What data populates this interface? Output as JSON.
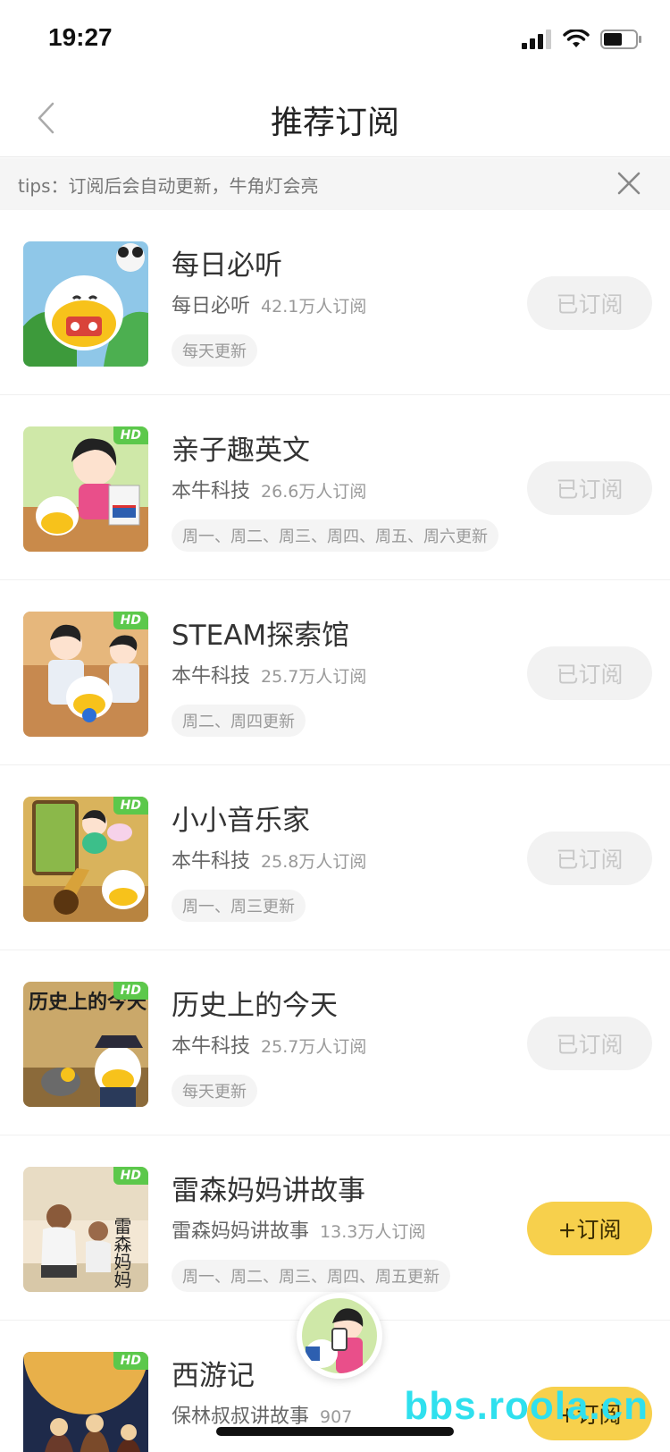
{
  "status_bar": {
    "time": "19:27"
  },
  "nav": {
    "title": "推荐订阅"
  },
  "tips": {
    "text": "tips：订阅后会自动更新，牛角灯会亮"
  },
  "subscriptions": [
    {
      "title": "每日必听",
      "author": "每日必听",
      "count": "42.1万人订阅",
      "schedule": "每天更新",
      "hd": false,
      "button": "已订阅",
      "subscribed": true
    },
    {
      "title": "亲子趣英文",
      "author": "本牛科技",
      "count": "26.6万人订阅",
      "schedule": "周一、周二、周三、周四、周五、周六更新",
      "hd": true,
      "hd_label": "HD",
      "button": "已订阅",
      "subscribed": true
    },
    {
      "title": "STEAM探索馆",
      "author": "本牛科技",
      "count": "25.7万人订阅",
      "schedule": "周二、周四更新",
      "hd": true,
      "hd_label": "HD",
      "button": "已订阅",
      "subscribed": true
    },
    {
      "title": "小小音乐家",
      "author": "本牛科技",
      "count": "25.8万人订阅",
      "schedule": "周一、周三更新",
      "hd": true,
      "hd_label": "HD",
      "button": "已订阅",
      "subscribed": true
    },
    {
      "title": "历史上的今天",
      "author": "本牛科技",
      "count": "25.7万人订阅",
      "schedule": "每天更新",
      "hd": true,
      "hd_label": "HD",
      "thumb_text": "历史上的今天",
      "button": "已订阅",
      "subscribed": true
    },
    {
      "title": "雷森妈妈讲故事",
      "author": "雷森妈妈讲故事",
      "count": "13.3万人订阅",
      "schedule": "周一、周二、周三、周四、周五更新",
      "hd": true,
      "hd_label": "HD",
      "thumb_text": "雷森妈妈",
      "button": "+订阅",
      "subscribed": false
    },
    {
      "title": "西游记",
      "author": "保林叔叔讲故事",
      "count": "907",
      "schedule": "",
      "hd": true,
      "hd_label": "HD",
      "button": "+订阅",
      "subscribed": false
    }
  ],
  "watermark": "bbs.roola.cn",
  "colors": {
    "accent_yellow": "#f7d04c",
    "hd_green": "#5cc84b",
    "watermark_cyan": "#2fe0ee"
  }
}
